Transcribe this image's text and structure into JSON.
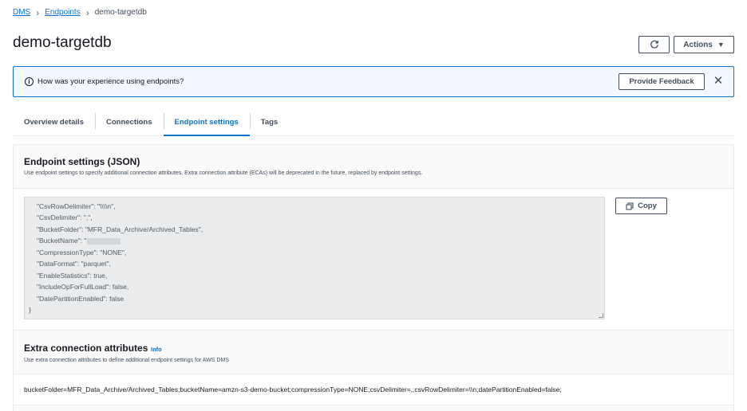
{
  "breadcrumb": {
    "items": [
      "DMS",
      "Endpoints"
    ],
    "current": "demo-targetdb"
  },
  "page": {
    "title": "demo-targetdb",
    "actions_label": "Actions"
  },
  "feedback": {
    "text": "How was your experience using endpoints?",
    "button_label": "Provide Feedback"
  },
  "tabs": [
    {
      "label": "Overview details",
      "active": false
    },
    {
      "label": "Connections",
      "active": false
    },
    {
      "label": "Endpoint settings",
      "active": true
    },
    {
      "label": "Tags",
      "active": false
    }
  ],
  "endpoint_settings": {
    "title": "Endpoint settings (JSON)",
    "description": "Use endpoint settings to specify additional connection attributes. Extra connection attribute (ECAs) will be deprecated in the future, replaced by endpoint settings.",
    "copy_label": "Copy",
    "json_lines": [
      "\"CsvRowDelimiter\": \"\\\\\\\\n\",",
      "\"CsvDelimiter\": \",\",",
      "\"BucketFolder\": \"MFR_Data_Archive/Archived_Tables\",",
      "\"BucketName\": \"",
      "\"CompressionType\": \"NONE\",",
      "\"DataFormat\": \"parquet\",",
      "\"EnableStatistics\": true,",
      "\"IncludeOpForFullLoad\": false,",
      "\"DatePartitionEnabled\": false"
    ],
    "closing_brace": "}"
  },
  "extra_attributes": {
    "title": "Extra connection attributes",
    "info_label": "Info",
    "description": "Use extra connection attributes to define additional endpoint settings for AWS DMS",
    "value": "bucketFolder=MFR_Data_Archive/Archived_Tables;bucketName=amzn-s3-demo-bucket;compressionType=NONE;csvDelimiter=,;csvRowDelimiter=\\\\n;datePartitionEnabled=false;"
  },
  "colors": {
    "link": "#0972d3",
    "text": "#16191f",
    "feedback_bg": "#f2f8fd",
    "code_bg": "#e9ebed"
  },
  "icons": [
    "chevron-right-icon",
    "refresh-icon",
    "caret-down-icon",
    "info-icon",
    "close-icon",
    "copy-icon"
  ]
}
